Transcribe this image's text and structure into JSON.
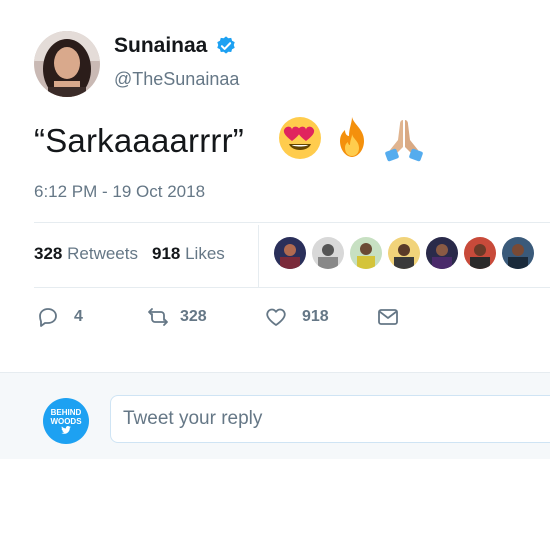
{
  "author": {
    "name": "Sunainaa",
    "handle": "@TheSunainaa",
    "verified": true
  },
  "tweet": {
    "text": "“Sarkaaaarrrr”",
    "emojis": [
      "heart-eyes-emoji",
      "fire-emoji",
      "folded-hands-emoji"
    ],
    "timestamp": "6:12 PM - 19 Oct 2018"
  },
  "stats": {
    "retweets_count": "328",
    "retweets_label": "Retweets",
    "likes_count": "918",
    "likes_label": "Likes"
  },
  "likers": [
    "liker-avatar-1",
    "liker-avatar-2",
    "liker-avatar-3",
    "liker-avatar-4",
    "liker-avatar-5",
    "liker-avatar-6",
    "liker-avatar-7"
  ],
  "actions": {
    "reply_count": "4",
    "retweet_count": "328",
    "like_count": "918"
  },
  "reply": {
    "placeholder": "Tweet your reply",
    "avatar_text_line1": "BEHIND",
    "avatar_text_line2": "WOODS"
  },
  "colors": {
    "accent": "#1da1f2",
    "muted": "#657786",
    "border": "#e6ecf0"
  }
}
